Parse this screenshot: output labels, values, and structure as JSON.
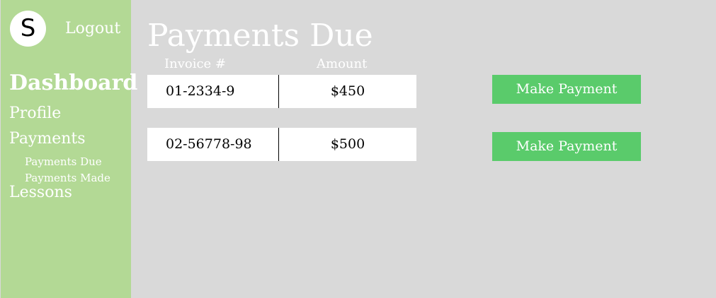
{
  "user": {
    "avatar_initial": "S"
  },
  "sidebar": {
    "logout_label": "Logout",
    "nav": {
      "dashboard": "Dashboard",
      "profile": "Profile",
      "payments": "Payments",
      "payments_due": "Payments Due",
      "payments_made": "Payments Made",
      "lessons": "Lessons"
    }
  },
  "main": {
    "title": "Payments Due",
    "columns": {
      "invoice": "Invoice #",
      "amount": "Amount"
    },
    "rows": [
      {
        "invoice": "01-2334-9",
        "amount": "$450",
        "action": "Make Payment"
      },
      {
        "invoice": "02-56778-98",
        "amount": "$500",
        "action": "Make Payment"
      }
    ]
  },
  "colors": {
    "background": "#d9d9d9",
    "sidebar": "#b3d995",
    "button": "#5acb6b",
    "text_light": "#ffffff"
  }
}
